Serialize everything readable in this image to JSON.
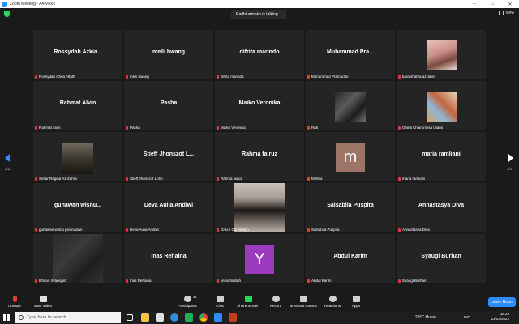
{
  "window": {
    "title": "Zoom Meeting - A4-VR62"
  },
  "meeting": {
    "talking": "Radhi atmoko is talking...",
    "view_label": "View"
  },
  "gallery": {
    "page_left": "2/2",
    "page_right": "2/2",
    "tiles": [
      {
        "name": "Rossydah Azkia...",
        "label": "Rossydah Azkia Alfath"
      },
      {
        "name": "melli hwang",
        "label": "melli hwang"
      },
      {
        "name": "difrita marindo",
        "label": "difrita marindo"
      },
      {
        "name": "Muhammad Pra...",
        "label": "Muhammad Pramudito"
      },
      {
        "name": "",
        "label": "tiara shafira azzahra"
      },
      {
        "name": "Rahmat Alvin",
        "label": "Rahmat Alvin"
      },
      {
        "name": "Pasha",
        "label": "Pasha"
      },
      {
        "name": "Maiko Veronika",
        "label": "Maiko Veronika"
      },
      {
        "name": "",
        "label": "Rafi"
      },
      {
        "name": "",
        "label": "Ghina Khairunnisa Utami"
      },
      {
        "name": "",
        "label": "Setiar Regina Az-Zahra"
      },
      {
        "name": "Stieff Jhonszot L...",
        "label": "Stieff Jhonszot Loho"
      },
      {
        "name": "Rahma fairuz",
        "label": "Rahma fairuz"
      },
      {
        "name": "",
        "label": "Melfira",
        "avatar": "m"
      },
      {
        "name": "maria ramliani",
        "label": "maria ramliani"
      },
      {
        "name": "gunawan wisnu...",
        "label": "gunawan wisnu pramudian"
      },
      {
        "name": "Deva Aulia Andiwi",
        "label": "Deva Aulia Andiwi"
      },
      {
        "name": "",
        "label": "Grace Chrystalyn"
      },
      {
        "name": "Salsabila Puspita",
        "label": "Salsabila Puspita"
      },
      {
        "name": "Annastasya Diva",
        "label": "Annastasya Diva"
      },
      {
        "name": "",
        "label": "Ikhsan Irvansyah"
      },
      {
        "name": "Inas Rehaina",
        "label": "Inas Rehaina"
      },
      {
        "name": "",
        "label": "yessi baldah",
        "avatar": "Y"
      },
      {
        "name": "Abdul Karim",
        "label": "Abdul Karim"
      },
      {
        "name": "Syaugi Burhan",
        "label": "Syaugi Burhan"
      }
    ]
  },
  "toolbar": {
    "unmute": "Unmute",
    "start_video": "Start Video",
    "participants": "Participants",
    "participants_count": "31",
    "chat": "Chat",
    "share_screen": "Share Screen",
    "record": "Record",
    "breakout": "Breakout Rooms",
    "reactions": "Reactions",
    "apps": "Apps",
    "leave": "Leave Room"
  },
  "taskbar": {
    "search_placeholder": "Type here to search",
    "weather": "29°C  Hujan",
    "language": "IND",
    "time": "16:24",
    "date": "23/03/2022"
  },
  "colors": {
    "accent": "#2d8cff",
    "share": "#23d959",
    "mute": "#e53935"
  }
}
